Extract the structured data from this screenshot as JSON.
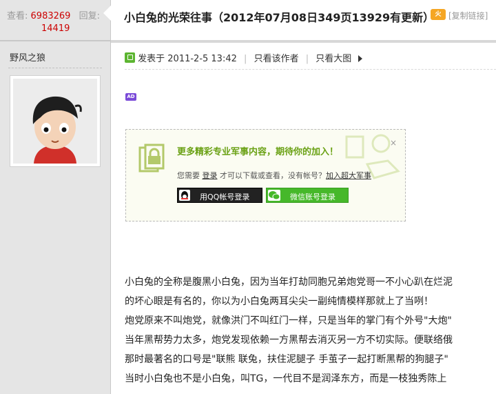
{
  "sidebar": {
    "view_label": "查看:",
    "view_count": "6983269",
    "reply_label": "回复:",
    "reply_count": "14419",
    "author_name": "野风之狼"
  },
  "header": {
    "title": "小白兔的光荣往事（2012年07月08日349页13929有更新）",
    "badge": "火",
    "copy_link": "[复制链接]"
  },
  "post_meta": {
    "posted": "发表于 2011-2-5 13:42",
    "only_author": "只看该作者",
    "large_image": "只看大图"
  },
  "ad_label": "AD",
  "login_box": {
    "title": "更多精彩专业军事内容，期待你的加入！",
    "prompt_prefix": "您需要",
    "login_link": "登录",
    "prompt_middle": "才可以下载或查看，没有帐号？",
    "join_link": "加入超大军事",
    "close": "×",
    "qq_button": "用QQ帐号登录",
    "wechat_button": "微信账号登录"
  },
  "body_lines": [
    "小白兔的全称是腹黑小白兔，因为当年打劫同胞兄弟炮党哥一不小心趴在烂泥",
    "的坏心眼是有名的，你以为小白兔两耳尖尖一副纯情模样那就上了当咧！",
    "炮党原来不叫炮党，就像洪门不叫红门一样，只是当年的掌门有个外号\"大炮\"",
    "当年黑帮势力太多，炮党发现依赖一方黑帮去消灭另一方不切实际。便联络俄",
    "那时最著名的口号是\"联熊 联兔，扶住泥腿子 手茧子一起打断黑帮的狗腿子\"",
    "当时小白兔也不是小白兔，叫TG，一代目不是润泽东方，而是一枝独秀陈上"
  ],
  "colors": {
    "count_red": "#cc0000",
    "promo_green": "#6aa114",
    "wechat_green": "#46b82a"
  }
}
